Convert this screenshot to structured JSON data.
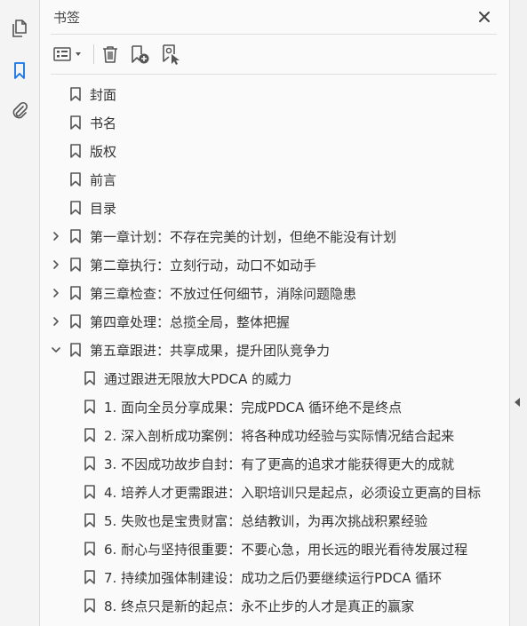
{
  "panel": {
    "title": "书签",
    "close_icon": "close-icon"
  },
  "leftbar": {
    "items": [
      {
        "name": "pages-icon",
        "active": false
      },
      {
        "name": "bookmark-icon",
        "active": true
      },
      {
        "name": "attachment-icon",
        "active": false
      }
    ]
  },
  "toolbar": {
    "buttons": [
      "options-menu-icon",
      "delete-icon",
      "new-bookmark-icon",
      "bookmark-from-selection-icon"
    ]
  },
  "bookmarks": [
    {
      "label": "封面",
      "level": 0,
      "expander": "none"
    },
    {
      "label": "书名",
      "level": 0,
      "expander": "none"
    },
    {
      "label": "版权",
      "level": 0,
      "expander": "none"
    },
    {
      "label": "前言",
      "level": 0,
      "expander": "none"
    },
    {
      "label": "目录",
      "level": 0,
      "expander": "none"
    },
    {
      "label": "第一章计划：不存在完美的计划，但绝不能没有计划",
      "level": 0,
      "expander": "collapsed"
    },
    {
      "label": "第二章执行：立刻行动，动口不如动手",
      "level": 0,
      "expander": "collapsed"
    },
    {
      "label": "第三章检查：不放过任何细节，消除问题隐患",
      "level": 0,
      "expander": "collapsed"
    },
    {
      "label": "第四章处理：总揽全局，整体把握",
      "level": 0,
      "expander": "collapsed"
    },
    {
      "label": "第五章跟进：共享成果，提升团队竞争力",
      "level": 0,
      "expander": "expanded"
    },
    {
      "label": "通过跟进无限放大PDCA 的威力",
      "level": 1,
      "expander": "none"
    },
    {
      "label": "1. 面向全员分享成果：完成PDCA 循环绝不是终点",
      "level": 1,
      "expander": "none"
    },
    {
      "label": "2. 深入剖析成功案例：将各种成功经验与实际情况结合起来",
      "level": 1,
      "expander": "none"
    },
    {
      "label": "3. 不因成功故步自封：有了更高的追求才能获得更大的成就",
      "level": 1,
      "expander": "none"
    },
    {
      "label": "4. 培养人才更需跟进：入职培训只是起点，必须设立更高的目标",
      "level": 1,
      "expander": "none"
    },
    {
      "label": "5. 失败也是宝贵财富：总结教训，为再次挑战积累经验",
      "level": 1,
      "expander": "none"
    },
    {
      "label": "6. 耐心与坚持很重要：不要心急，用长远的眼光看待发展过程",
      "level": 1,
      "expander": "none"
    },
    {
      "label": "7. 持续加强体制建设：成功之后仍要继续运行PDCA 循环",
      "level": 1,
      "expander": "none"
    },
    {
      "label": "8. 终点只是新的起点：永不止步的人才是真正的赢家",
      "level": 1,
      "expander": "none"
    }
  ],
  "colors": {
    "accent": "#1473e6",
    "icon": "#555555"
  }
}
